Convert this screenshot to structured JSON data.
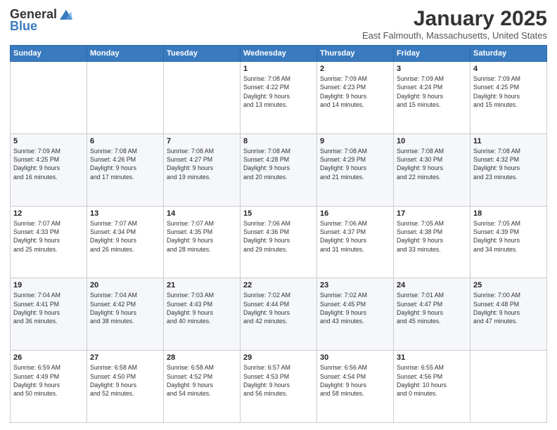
{
  "logo": {
    "general": "General",
    "blue": "Blue"
  },
  "title": "January 2025",
  "location": "East Falmouth, Massachusetts, United States",
  "days_header": [
    "Sunday",
    "Monday",
    "Tuesday",
    "Wednesday",
    "Thursday",
    "Friday",
    "Saturday"
  ],
  "weeks": [
    [
      {
        "day": "",
        "info": ""
      },
      {
        "day": "",
        "info": ""
      },
      {
        "day": "",
        "info": ""
      },
      {
        "day": "1",
        "info": "Sunrise: 7:08 AM\nSunset: 4:22 PM\nDaylight: 9 hours\nand 13 minutes."
      },
      {
        "day": "2",
        "info": "Sunrise: 7:09 AM\nSunset: 4:23 PM\nDaylight: 9 hours\nand 14 minutes."
      },
      {
        "day": "3",
        "info": "Sunrise: 7:09 AM\nSunset: 4:24 PM\nDaylight: 9 hours\nand 15 minutes."
      },
      {
        "day": "4",
        "info": "Sunrise: 7:09 AM\nSunset: 4:25 PM\nDaylight: 9 hours\nand 15 minutes."
      }
    ],
    [
      {
        "day": "5",
        "info": "Sunrise: 7:09 AM\nSunset: 4:25 PM\nDaylight: 9 hours\nand 16 minutes."
      },
      {
        "day": "6",
        "info": "Sunrise: 7:08 AM\nSunset: 4:26 PM\nDaylight: 9 hours\nand 17 minutes."
      },
      {
        "day": "7",
        "info": "Sunrise: 7:08 AM\nSunset: 4:27 PM\nDaylight: 9 hours\nand 19 minutes."
      },
      {
        "day": "8",
        "info": "Sunrise: 7:08 AM\nSunset: 4:28 PM\nDaylight: 9 hours\nand 20 minutes."
      },
      {
        "day": "9",
        "info": "Sunrise: 7:08 AM\nSunset: 4:29 PM\nDaylight: 9 hours\nand 21 minutes."
      },
      {
        "day": "10",
        "info": "Sunrise: 7:08 AM\nSunset: 4:30 PM\nDaylight: 9 hours\nand 22 minutes."
      },
      {
        "day": "11",
        "info": "Sunrise: 7:08 AM\nSunset: 4:32 PM\nDaylight: 9 hours\nand 23 minutes."
      }
    ],
    [
      {
        "day": "12",
        "info": "Sunrise: 7:07 AM\nSunset: 4:33 PM\nDaylight: 9 hours\nand 25 minutes."
      },
      {
        "day": "13",
        "info": "Sunrise: 7:07 AM\nSunset: 4:34 PM\nDaylight: 9 hours\nand 26 minutes."
      },
      {
        "day": "14",
        "info": "Sunrise: 7:07 AM\nSunset: 4:35 PM\nDaylight: 9 hours\nand 28 minutes."
      },
      {
        "day": "15",
        "info": "Sunrise: 7:06 AM\nSunset: 4:36 PM\nDaylight: 9 hours\nand 29 minutes."
      },
      {
        "day": "16",
        "info": "Sunrise: 7:06 AM\nSunset: 4:37 PM\nDaylight: 9 hours\nand 31 minutes."
      },
      {
        "day": "17",
        "info": "Sunrise: 7:05 AM\nSunset: 4:38 PM\nDaylight: 9 hours\nand 33 minutes."
      },
      {
        "day": "18",
        "info": "Sunrise: 7:05 AM\nSunset: 4:39 PM\nDaylight: 9 hours\nand 34 minutes."
      }
    ],
    [
      {
        "day": "19",
        "info": "Sunrise: 7:04 AM\nSunset: 4:41 PM\nDaylight: 9 hours\nand 36 minutes."
      },
      {
        "day": "20",
        "info": "Sunrise: 7:04 AM\nSunset: 4:42 PM\nDaylight: 9 hours\nand 38 minutes."
      },
      {
        "day": "21",
        "info": "Sunrise: 7:03 AM\nSunset: 4:43 PM\nDaylight: 9 hours\nand 40 minutes."
      },
      {
        "day": "22",
        "info": "Sunrise: 7:02 AM\nSunset: 4:44 PM\nDaylight: 9 hours\nand 42 minutes."
      },
      {
        "day": "23",
        "info": "Sunrise: 7:02 AM\nSunset: 4:45 PM\nDaylight: 9 hours\nand 43 minutes."
      },
      {
        "day": "24",
        "info": "Sunrise: 7:01 AM\nSunset: 4:47 PM\nDaylight: 9 hours\nand 45 minutes."
      },
      {
        "day": "25",
        "info": "Sunrise: 7:00 AM\nSunset: 4:48 PM\nDaylight: 9 hours\nand 47 minutes."
      }
    ],
    [
      {
        "day": "26",
        "info": "Sunrise: 6:59 AM\nSunset: 4:49 PM\nDaylight: 9 hours\nand 50 minutes."
      },
      {
        "day": "27",
        "info": "Sunrise: 6:58 AM\nSunset: 4:50 PM\nDaylight: 9 hours\nand 52 minutes."
      },
      {
        "day": "28",
        "info": "Sunrise: 6:58 AM\nSunset: 4:52 PM\nDaylight: 9 hours\nand 54 minutes."
      },
      {
        "day": "29",
        "info": "Sunrise: 6:57 AM\nSunset: 4:53 PM\nDaylight: 9 hours\nand 56 minutes."
      },
      {
        "day": "30",
        "info": "Sunrise: 6:56 AM\nSunset: 4:54 PM\nDaylight: 9 hours\nand 58 minutes."
      },
      {
        "day": "31",
        "info": "Sunrise: 6:55 AM\nSunset: 4:56 PM\nDaylight: 10 hours\nand 0 minutes."
      },
      {
        "day": "",
        "info": ""
      }
    ]
  ]
}
